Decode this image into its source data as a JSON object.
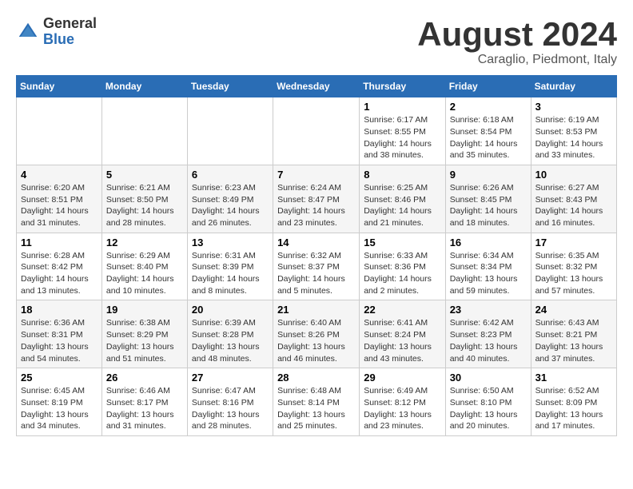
{
  "logo": {
    "general": "General",
    "blue": "Blue"
  },
  "title": "August 2024",
  "subtitle": "Caraglio, Piedmont, Italy",
  "days_of_week": [
    "Sunday",
    "Monday",
    "Tuesday",
    "Wednesday",
    "Thursday",
    "Friday",
    "Saturday"
  ],
  "weeks": [
    [
      {
        "day": "",
        "info": ""
      },
      {
        "day": "",
        "info": ""
      },
      {
        "day": "",
        "info": ""
      },
      {
        "day": "",
        "info": ""
      },
      {
        "day": "1",
        "sunrise": "6:17 AM",
        "sunset": "8:55 PM",
        "daylight": "14 hours and 38 minutes."
      },
      {
        "day": "2",
        "sunrise": "6:18 AM",
        "sunset": "8:54 PM",
        "daylight": "14 hours and 35 minutes."
      },
      {
        "day": "3",
        "sunrise": "6:19 AM",
        "sunset": "8:53 PM",
        "daylight": "14 hours and 33 minutes."
      }
    ],
    [
      {
        "day": "4",
        "sunrise": "6:20 AM",
        "sunset": "8:51 PM",
        "daylight": "14 hours and 31 minutes."
      },
      {
        "day": "5",
        "sunrise": "6:21 AM",
        "sunset": "8:50 PM",
        "daylight": "14 hours and 28 minutes."
      },
      {
        "day": "6",
        "sunrise": "6:23 AM",
        "sunset": "8:49 PM",
        "daylight": "14 hours and 26 minutes."
      },
      {
        "day": "7",
        "sunrise": "6:24 AM",
        "sunset": "8:47 PM",
        "daylight": "14 hours and 23 minutes."
      },
      {
        "day": "8",
        "sunrise": "6:25 AM",
        "sunset": "8:46 PM",
        "daylight": "14 hours and 21 minutes."
      },
      {
        "day": "9",
        "sunrise": "6:26 AM",
        "sunset": "8:45 PM",
        "daylight": "14 hours and 18 minutes."
      },
      {
        "day": "10",
        "sunrise": "6:27 AM",
        "sunset": "8:43 PM",
        "daylight": "14 hours and 16 minutes."
      }
    ],
    [
      {
        "day": "11",
        "sunrise": "6:28 AM",
        "sunset": "8:42 PM",
        "daylight": "14 hours and 13 minutes."
      },
      {
        "day": "12",
        "sunrise": "6:29 AM",
        "sunset": "8:40 PM",
        "daylight": "14 hours and 10 minutes."
      },
      {
        "day": "13",
        "sunrise": "6:31 AM",
        "sunset": "8:39 PM",
        "daylight": "14 hours and 8 minutes."
      },
      {
        "day": "14",
        "sunrise": "6:32 AM",
        "sunset": "8:37 PM",
        "daylight": "14 hours and 5 minutes."
      },
      {
        "day": "15",
        "sunrise": "6:33 AM",
        "sunset": "8:36 PM",
        "daylight": "14 hours and 2 minutes."
      },
      {
        "day": "16",
        "sunrise": "6:34 AM",
        "sunset": "8:34 PM",
        "daylight": "13 hours and 59 minutes."
      },
      {
        "day": "17",
        "sunrise": "6:35 AM",
        "sunset": "8:32 PM",
        "daylight": "13 hours and 57 minutes."
      }
    ],
    [
      {
        "day": "18",
        "sunrise": "6:36 AM",
        "sunset": "8:31 PM",
        "daylight": "13 hours and 54 minutes."
      },
      {
        "day": "19",
        "sunrise": "6:38 AM",
        "sunset": "8:29 PM",
        "daylight": "13 hours and 51 minutes."
      },
      {
        "day": "20",
        "sunrise": "6:39 AM",
        "sunset": "8:28 PM",
        "daylight": "13 hours and 48 minutes."
      },
      {
        "day": "21",
        "sunrise": "6:40 AM",
        "sunset": "8:26 PM",
        "daylight": "13 hours and 46 minutes."
      },
      {
        "day": "22",
        "sunrise": "6:41 AM",
        "sunset": "8:24 PM",
        "daylight": "13 hours and 43 minutes."
      },
      {
        "day": "23",
        "sunrise": "6:42 AM",
        "sunset": "8:23 PM",
        "daylight": "13 hours and 40 minutes."
      },
      {
        "day": "24",
        "sunrise": "6:43 AM",
        "sunset": "8:21 PM",
        "daylight": "13 hours and 37 minutes."
      }
    ],
    [
      {
        "day": "25",
        "sunrise": "6:45 AM",
        "sunset": "8:19 PM",
        "daylight": "13 hours and 34 minutes."
      },
      {
        "day": "26",
        "sunrise": "6:46 AM",
        "sunset": "8:17 PM",
        "daylight": "13 hours and 31 minutes."
      },
      {
        "day": "27",
        "sunrise": "6:47 AM",
        "sunset": "8:16 PM",
        "daylight": "13 hours and 28 minutes."
      },
      {
        "day": "28",
        "sunrise": "6:48 AM",
        "sunset": "8:14 PM",
        "daylight": "13 hours and 25 minutes."
      },
      {
        "day": "29",
        "sunrise": "6:49 AM",
        "sunset": "8:12 PM",
        "daylight": "13 hours and 23 minutes."
      },
      {
        "day": "30",
        "sunrise": "6:50 AM",
        "sunset": "8:10 PM",
        "daylight": "13 hours and 20 minutes."
      },
      {
        "day": "31",
        "sunrise": "6:52 AM",
        "sunset": "8:09 PM",
        "daylight": "13 hours and 17 minutes."
      }
    ]
  ],
  "labels": {
    "sunrise": "Sunrise:",
    "sunset": "Sunset:",
    "daylight": "Daylight:"
  }
}
